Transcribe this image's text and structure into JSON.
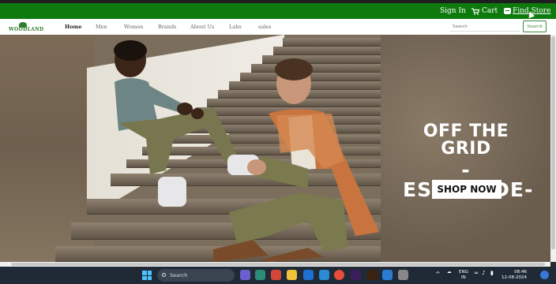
{
  "header": {
    "sign_in": "Sign In",
    "cart": "Cart",
    "find_store": "Find Store"
  },
  "nav": {
    "logo": "WOODLAND",
    "items": [
      "Home",
      "Men",
      "Women",
      "Brands",
      "About Us",
      "Labs",
      "sales"
    ],
    "search_placeholder": "Search",
    "search_button": "Search"
  },
  "hero": {
    "headline_line1": "OFF THE GRID",
    "headline_line2": "-ESCAPADE-",
    "cta": "SHOP NOW"
  },
  "taskbar": {
    "search_label": "Search",
    "lang_line1": "ENG",
    "lang_line2": "IN",
    "time": "08:46",
    "date": "12-08-2024"
  },
  "icons": [
    "cart-icon",
    "store-icon",
    "windows-icon",
    "search-icon",
    "wifi-icon",
    "volume-icon",
    "battery-icon"
  ]
}
